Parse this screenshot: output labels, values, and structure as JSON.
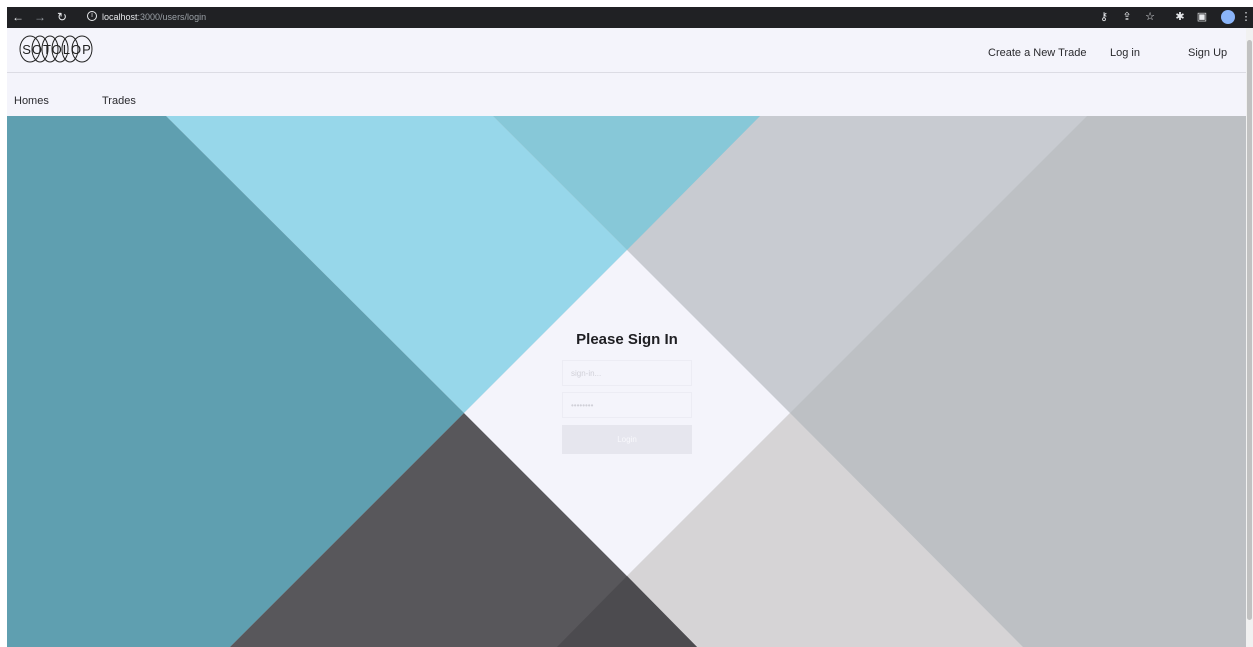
{
  "browser": {
    "url_host": "localhost",
    "url_path": ":3000/users/login"
  },
  "header": {
    "logo_text": "SOTOLOP",
    "nav": {
      "create_trade": "Create a New Trade",
      "login": "Log in",
      "signup": "Sign Up"
    }
  },
  "subnav": {
    "homes": "Homes",
    "trades": "Trades"
  },
  "login_form": {
    "title": "Please Sign In",
    "email_placeholder": "sign-in...",
    "password_placeholder": "••••••••",
    "submit_label": "Login"
  },
  "colors": {
    "teal": "#5f9fb0",
    "light_blue": "#97d7ea",
    "mid_blue": "#87c8d8",
    "gray_light": "#c8cbd1",
    "gray": "#bdc0c4",
    "dark": "#58575b",
    "beige": "#d6d4d6",
    "white_center": "#f4f4fb"
  }
}
